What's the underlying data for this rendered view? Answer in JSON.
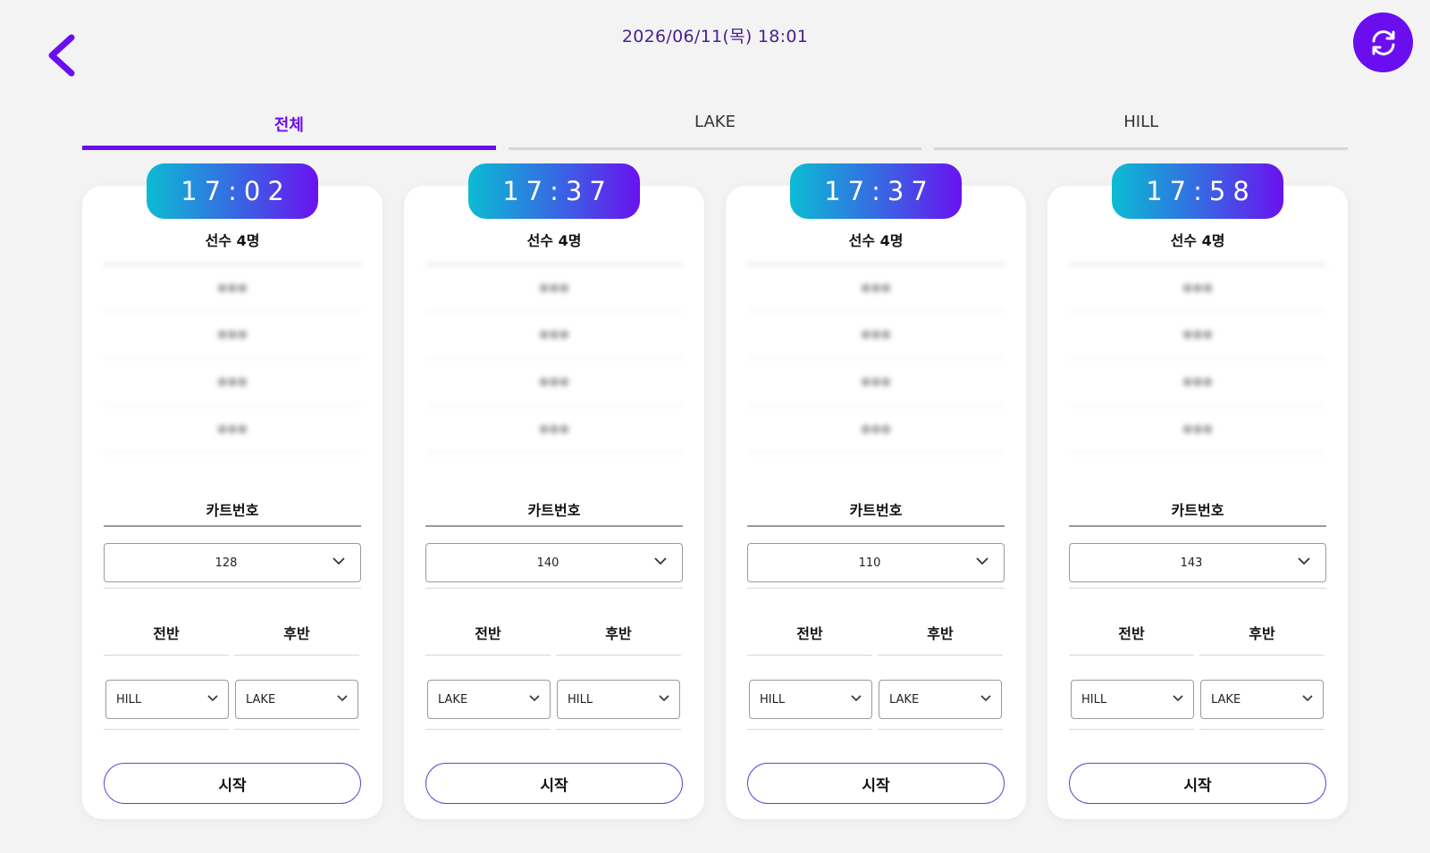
{
  "header": {
    "datetime": "2026/06/11(목) 18:01"
  },
  "tabs": [
    {
      "label": "전체",
      "active": true
    },
    {
      "label": "LAKE",
      "active": false
    },
    {
      "label": "HILL",
      "active": false
    }
  ],
  "colors": {
    "accent": "#6a0ef0",
    "date_text": "#4a1f8c"
  },
  "labels": {
    "cart_number": "카트번호",
    "first_half": "전반",
    "second_half": "후반",
    "start": "시작"
  },
  "cards": [
    {
      "time": "17:02",
      "players": "선수 4명",
      "cart": "128",
      "first": "HILL",
      "second": "LAKE"
    },
    {
      "time": "17:37",
      "players": "선수 4명",
      "cart": "140",
      "first": "LAKE",
      "second": "HILL"
    },
    {
      "time": "17:37",
      "players": "선수 4명",
      "cart": "110",
      "first": "HILL",
      "second": "LAKE"
    },
    {
      "time": "17:58",
      "players": "선수 4명",
      "cart": "143",
      "first": "HILL",
      "second": "LAKE"
    }
  ]
}
